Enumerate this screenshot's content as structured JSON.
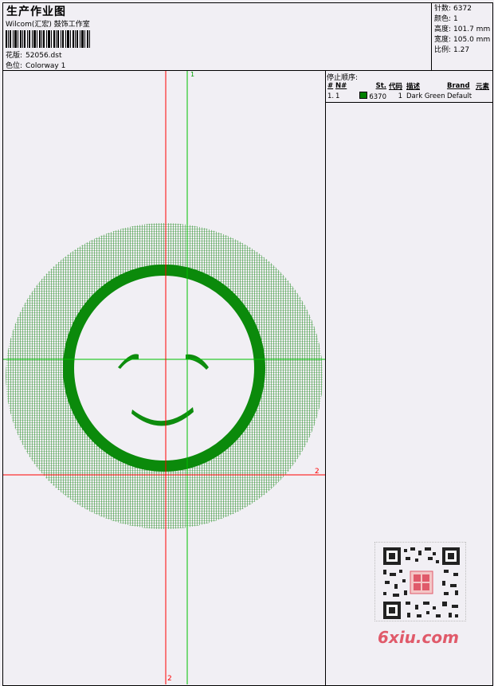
{
  "header": {
    "title": "生产作业图",
    "studio": "Wilcom(汇宏) 鼓饰工作室",
    "design_label": "花版:",
    "design_value": "52056.dst",
    "colorway_label": "色位:",
    "colorway_value": "Colorway 1"
  },
  "stats": {
    "stitches_label": "针数:",
    "stitches_value": "6372",
    "colors_label": "颜色:",
    "colors_value": "1",
    "height_label": "高度:",
    "height_value": "101.7 mm",
    "width_label": "宽度:",
    "width_value": "105.0 mm",
    "scale_label": "比例:",
    "scale_value": "1.27"
  },
  "canvas": {
    "green_axis_label": "1",
    "red_axis_label_right": "2",
    "red_axis_label_bottom": "2",
    "thread_color": "#008000",
    "red_axis_color": "#ff0000",
    "green_axis_color": "#00c000"
  },
  "stop_order": {
    "title": "停止顺序:",
    "headers": [
      "#",
      "N#",
      "St.",
      "代码",
      "描述",
      "Brand",
      "元素"
    ],
    "rows": [
      {
        "num": "1.",
        "n": "1",
        "st": "6370",
        "code": "1",
        "desc": "Dark Green",
        "brand": "Default",
        "elem": ""
      }
    ]
  },
  "watermark": {
    "text": "6xiu.com"
  }
}
